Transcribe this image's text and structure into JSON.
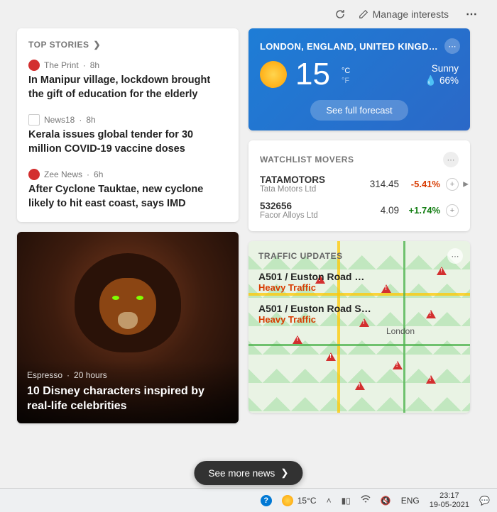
{
  "header": {
    "manage_interests": "Manage interests"
  },
  "topStories": {
    "heading": "TOP STORIES",
    "items": [
      {
        "source": "The Print",
        "age": "8h",
        "title": "In Manipur village, lockdown brought the gift of education for the elderly"
      },
      {
        "source": "News18",
        "age": "8h",
        "title": "Kerala issues global tender for 30 million COVID-19 vaccine doses"
      },
      {
        "source": "Zee News",
        "age": "6h",
        "title": "After Cyclone Tauktae, new cyclone likely to hit east coast, says IMD"
      }
    ]
  },
  "feature": {
    "source": "Espresso",
    "age": "20 hours",
    "title": "10 Disney characters inspired by real-life celebrities"
  },
  "weather": {
    "location": "LONDON, ENGLAND, UNITED KINGD…",
    "temp": "15",
    "unit_c": "°C",
    "unit_f": "°F",
    "condition": "Sunny",
    "humidity": "66%",
    "forecast_btn": "See full forecast"
  },
  "watchlist": {
    "heading": "WATCHLIST MOVERS",
    "items": [
      {
        "symbol": "TATAMOTORS",
        "name": "Tata Motors Ltd",
        "price": "314.45",
        "change": "-5.41%",
        "dir": "neg"
      },
      {
        "symbol": "532656",
        "name": "Facor Alloys Ltd",
        "price": "4.09",
        "change": "+1.74%",
        "dir": "pos"
      }
    ]
  },
  "traffic": {
    "heading": "TRAFFIC UPDATES",
    "city_label": "London",
    "items": [
      {
        "route": "A501 / Euston Road …",
        "status": "Heavy Traffic"
      },
      {
        "route": "A501 / Euston Road S…",
        "status": "Heavy Traffic"
      }
    ]
  },
  "moreNews": "See more news",
  "taskbar": {
    "temp": "15°C",
    "lang": "ENG",
    "time": "23:17",
    "date": "19-05-2021"
  }
}
